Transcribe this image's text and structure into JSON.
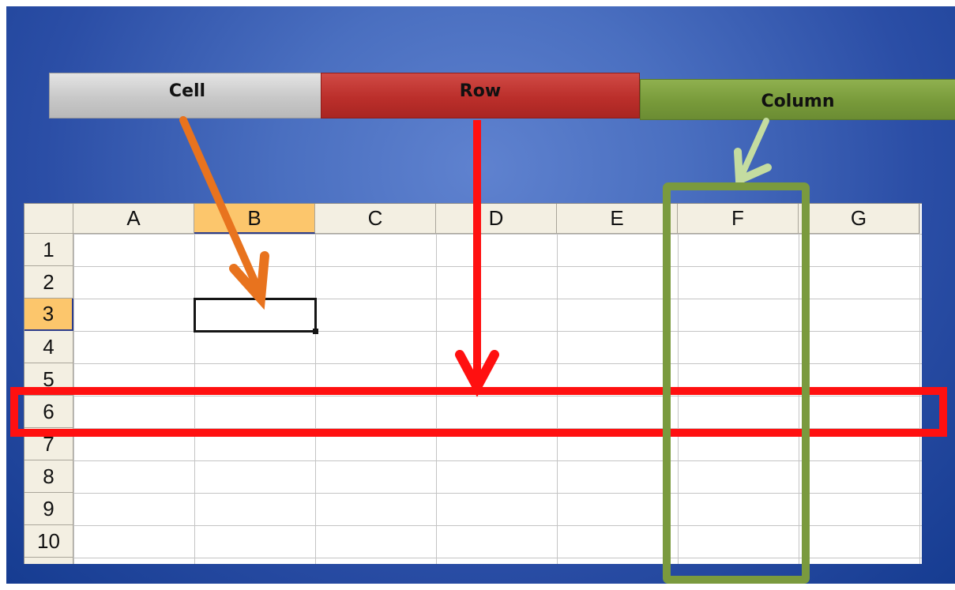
{
  "labels": {
    "cell": "Cell",
    "row": "Row",
    "column": "Column"
  },
  "spreadsheet": {
    "columns": [
      "A",
      "B",
      "C",
      "D",
      "E",
      "F",
      "G"
    ],
    "rows": [
      "1",
      "2",
      "3",
      "4",
      "5",
      "6",
      "7",
      "8",
      "9",
      "10"
    ],
    "selected_column": "B",
    "selected_row": "3",
    "highlighted_row": "6",
    "highlighted_column": "F"
  },
  "colors": {
    "cell_arrow": "#e8731e",
    "row_highlight": "#ff1010",
    "column_highlight": "#7a9a3e",
    "column_arrow": "#c4dca0",
    "header_selected": "#fcc66c"
  }
}
